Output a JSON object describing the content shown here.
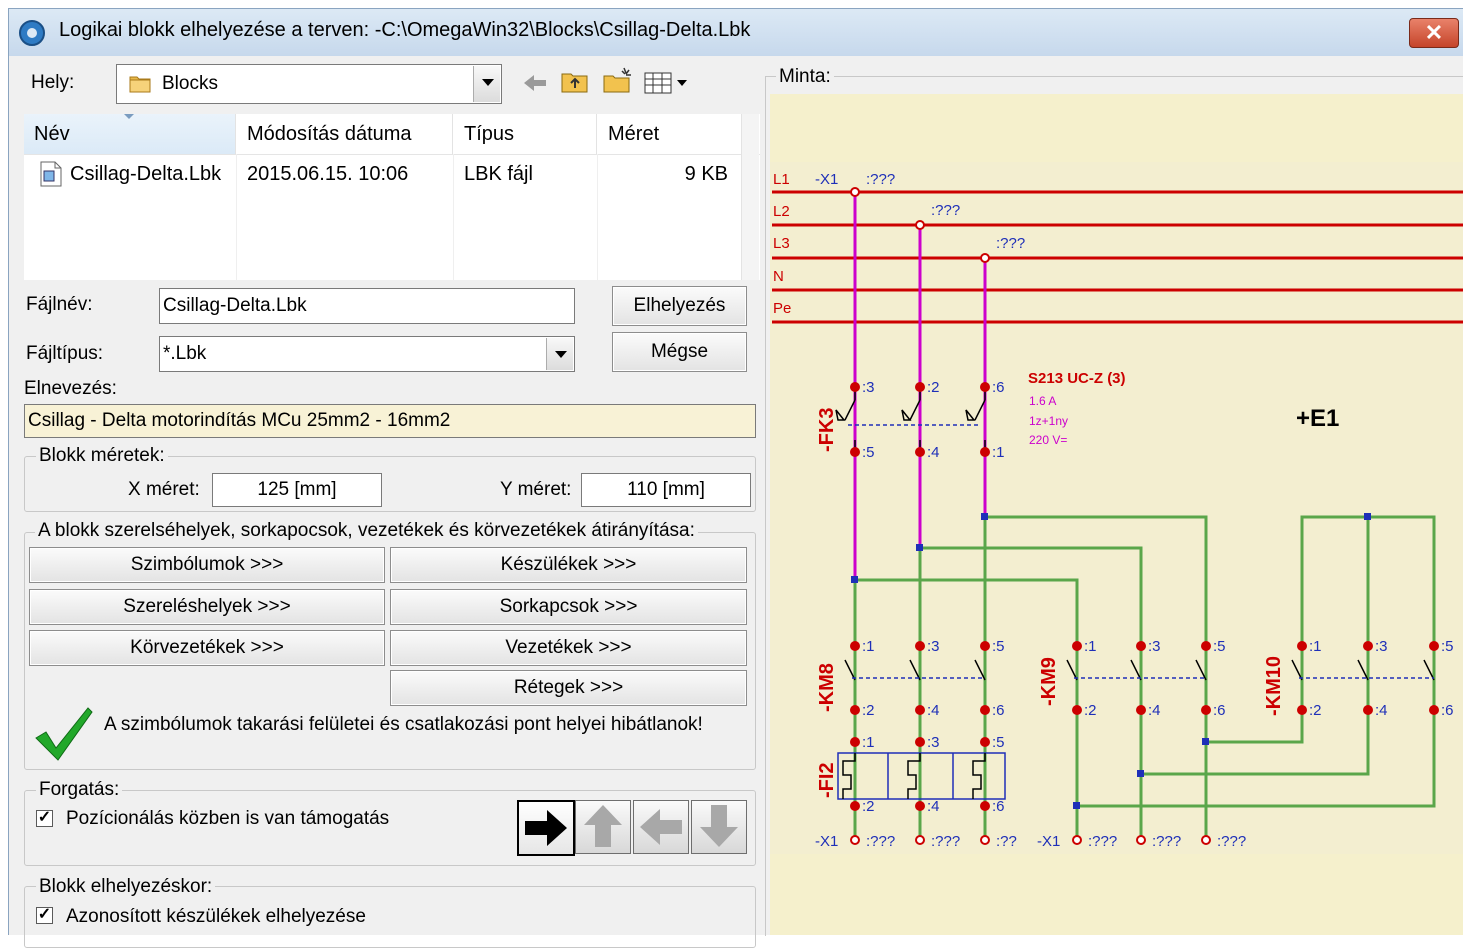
{
  "window": {
    "title": "Logikai blokk elhelyezése a terven: -C:\\OmegaWin32\\Blocks\\Csillag-Delta.Lbk",
    "close_glyph": "✕"
  },
  "location": {
    "label": "Hely:",
    "value": "Blocks"
  },
  "file_list": {
    "columns": [
      "Név",
      "Módosítás dátuma",
      "Típus",
      "Méret"
    ],
    "rows": [
      {
        "name": "Csillag-Delta.Lbk",
        "date": "2015.06.15. 10:06",
        "type": "LBK fájl",
        "size": "9 KB"
      }
    ]
  },
  "filename": {
    "label": "Fájlnév:",
    "value": "Csillag-Delta.Lbk"
  },
  "filetype": {
    "label": "Fájltípus:",
    "value": "*.Lbk"
  },
  "buttons": {
    "place": "Elhelyezés",
    "cancel": "Mégse"
  },
  "naming": {
    "label": "Elnevezés:",
    "value": "Csillag - Delta motorindítás MCu 25mm2 - 16mm2"
  },
  "block_sizes": {
    "legend": "Blokk méretek:",
    "x_label": "X méret:",
    "x_value": "125 [mm]",
    "y_label": "Y méret:",
    "y_value": "110 [mm]"
  },
  "redirect": {
    "legend": "A blokk szerelséhelyek, sorkapocsok, vezetékek és körvezetékek átirányítása:",
    "symbols": "Szimbólumok >>>",
    "devices": "Készülékek >>>",
    "mounting": "Szereléshelyek >>>",
    "terminals": "Sorkapcsok >>>",
    "loops": "Körvezetékek >>>",
    "wires": "Vezetékek >>>",
    "layers": "Rétegek >>>"
  },
  "status_message": "A szimbólumok takarási felületei és csatlakozási pont helyei hibátlanok!",
  "rotation": {
    "legend": "Forgatás:",
    "checkbox_label": "Pozícionálás közben is van támogatás",
    "checked": true,
    "selected_direction": "right"
  },
  "placement": {
    "legend": "Blokk elhelyezéskor:",
    "checkbox_label": "Azonosított készülékek elhelyezése",
    "checked": true
  },
  "preview": {
    "legend": "Minta:",
    "bus_labels": [
      "L1",
      "L2",
      "L3",
      "N",
      "Pe"
    ],
    "top_refs": [
      "-X1",
      ":???",
      ":???",
      ":???"
    ],
    "fk3": {
      "name": "-FK3",
      "pins_top": [
        ":3",
        ":2",
        ":6"
      ],
      "pins_bottom": [
        ":5",
        ":4",
        ":1"
      ],
      "spec1": "S213 UC-Z (3)",
      "spec2": "1.6 A",
      "spec3": "1z+1ny",
      "spec4": "220 V="
    },
    "location_mark": "+E1",
    "km8": {
      "name": "-KM8",
      "pins_top": [
        ":1",
        ":3",
        ":5"
      ],
      "pins_bottom": [
        ":2",
        ":4",
        ":6"
      ]
    },
    "km9": {
      "name": "-KM9",
      "pins_top": [
        ":1",
        ":3",
        ":5"
      ],
      "pins_bottom": [
        ":2",
        ":4",
        ":6"
      ]
    },
    "km10": {
      "name": "-KM10",
      "pins_top": [
        ":1",
        ":3",
        ":5"
      ],
      "pins_bottom": [
        ":2",
        ":4",
        ":6"
      ]
    },
    "fi2": {
      "name": "-FI2",
      "pins_top": [
        ":1",
        ":3",
        ":5"
      ],
      "pins_bottom": [
        ":2",
        ":4",
        ":6"
      ]
    },
    "bottom_refs": [
      "-X1",
      ":???",
      ":???",
      ":??",
      "-X1",
      ":???",
      ":???",
      ":???"
    ],
    "colors": {
      "bus": "#cc0000",
      "pink_wire": "#cc00cc",
      "green_wire": "#5aa64a",
      "label": "#cc0000",
      "node": "#1e2fb8",
      "background": "#f5f0cc",
      "fk3_spec": "#cc00cc"
    }
  }
}
